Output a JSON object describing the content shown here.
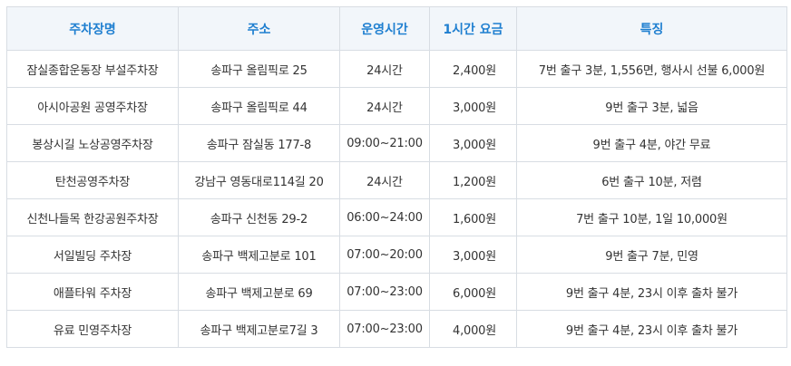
{
  "table": {
    "headers": [
      "주차장명",
      "주소",
      "운영시간",
      "1시간 요금",
      "특징"
    ],
    "rows": [
      [
        "잠실종합운동장 부설주차장",
        "송파구 올림픽로 25",
        "24시간",
        "2,400원",
        "7번 출구 3분, 1,556면, 행사시 선불 6,000원"
      ],
      [
        "아시아공원 공영주차장",
        "송파구 올림픽로 44",
        "24시간",
        "3,000원",
        "9번 출구 3분, 넓음"
      ],
      [
        "봉상시길 노상공영주차장",
        "송파구 잠실동 177-8",
        "09:00~21:00",
        "3,000원",
        "9번 출구 4분, 야간 무료"
      ],
      [
        "탄천공영주차장",
        "강남구 영동대로114길 20",
        "24시간",
        "1,200원",
        "6번 출구 10분, 저렴"
      ],
      [
        "신천나들목 한강공원주차장",
        "송파구 신천동 29-2",
        "06:00~24:00",
        "1,600원",
        "7번 출구 10분, 1일 10,000원"
      ],
      [
        "서일빌딩 주차장",
        "송파구 백제고분로 101",
        "07:00~20:00",
        "3,000원",
        "9번 출구 7분, 민영"
      ],
      [
        "애플타워 주차장",
        "송파구 백제고분로 69",
        "07:00~23:00",
        "6,000원",
        "9번 출구 4분, 23시 이후 출차 불가"
      ],
      [
        "유료 민영주차장",
        "송파구 백제고분로7길 3",
        "07:00~23:00",
        "4,000원",
        "9번 출구 4분, 23시 이후 출차 불가"
      ]
    ]
  },
  "colors": {
    "header_text": "#1f7fd0",
    "header_bg": "#f2f6fa",
    "border": "#d8dde3",
    "body_text": "#333333"
  }
}
